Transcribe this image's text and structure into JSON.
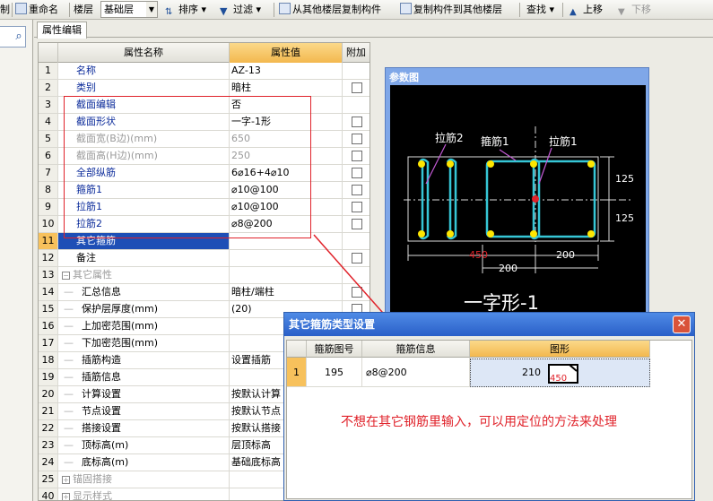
{
  "toolbar": {
    "cut_label": "制",
    "rename_label": "重命名",
    "floor_label": "楼层",
    "floor_value": "基础层",
    "sort_label": "排序",
    "filter_label": "过滤",
    "copy_from_label": "从其他楼层复制构件",
    "copy_to_label": "复制构件到其他楼层",
    "find_label": "查找",
    "up_label": "上移",
    "down_label": "下移"
  },
  "tab": {
    "label": "属性编辑"
  },
  "grid": {
    "headers": {
      "name": "属性名称",
      "value": "属性值",
      "extra": "附加"
    },
    "rows": [
      {
        "num": "1",
        "name": "名称",
        "value": "AZ-13"
      },
      {
        "num": "2",
        "name": "类别",
        "value": "暗柱"
      },
      {
        "num": "3",
        "name": "截面编辑",
        "value": "否"
      },
      {
        "num": "4",
        "name": "截面形状",
        "value": "一字-1形"
      },
      {
        "num": "5",
        "name": "截面宽(B边)(mm)",
        "value": "650"
      },
      {
        "num": "6",
        "name": "截面高(H边)(mm)",
        "value": "250"
      },
      {
        "num": "7",
        "name": "全部纵筋",
        "value": "6⌀16+4⌀10"
      },
      {
        "num": "8",
        "name": "箍筋1",
        "value": "⌀10@100"
      },
      {
        "num": "9",
        "name": "拉筋1",
        "value": "⌀10@100"
      },
      {
        "num": "10",
        "name": "拉筋2",
        "value": "⌀8@200"
      },
      {
        "num": "11",
        "name": "其它箍筋",
        "value": ""
      },
      {
        "num": "12",
        "name": "备注",
        "value": ""
      },
      {
        "num": "13",
        "name": "其它属性",
        "value": ""
      },
      {
        "num": "14",
        "name": "汇总信息",
        "value": "暗柱/端柱"
      },
      {
        "num": "15",
        "name": "保护层厚度(mm)",
        "value": "(20)"
      },
      {
        "num": "16",
        "name": "上加密范围(mm)",
        "value": ""
      },
      {
        "num": "17",
        "name": "下加密范围(mm)",
        "value": ""
      },
      {
        "num": "18",
        "name": "插筋构造",
        "value": "设置插筋"
      },
      {
        "num": "19",
        "name": "插筋信息",
        "value": ""
      },
      {
        "num": "20",
        "name": "计算设置",
        "value": "按默认计算"
      },
      {
        "num": "21",
        "name": "节点设置",
        "value": "按默认节点"
      },
      {
        "num": "22",
        "name": "搭接设置",
        "value": "按默认搭接"
      },
      {
        "num": "23",
        "name": "顶标高(m)",
        "value": "层顶标高"
      },
      {
        "num": "24",
        "name": "底标高(m)",
        "value": "基础底标高"
      },
      {
        "num": "25",
        "name": "锚固搭接",
        "value": ""
      },
      {
        "num": "40",
        "name": "显示样式",
        "value": ""
      }
    ]
  },
  "param": {
    "title": "参数图",
    "label_lajin2": "拉筋2",
    "label_gujin1": "箍筋1",
    "label_lajin1": "拉筋1",
    "dim_125a": "125",
    "dim_125b": "125",
    "dim_450": "450",
    "dim_200a": "200",
    "dim_200b": "200",
    "shape_name": "一字形-1"
  },
  "dialog": {
    "title": "其它箍筋类型设置",
    "close": "✕",
    "headers": {
      "code": "箍筋图号",
      "info": "箍筋信息",
      "shape": "图形"
    },
    "row": {
      "num": "1",
      "code": "195",
      "info": "⌀8@200",
      "shape_value": "210",
      "shape_dim": "450"
    },
    "note": "不想在其它钢筋里输入，可以用定位的方法来处理"
  },
  "colors": {
    "accent_red": "#e0222a",
    "select_blue": "#1e4fb6",
    "rebar_cyan": "#36c6d6",
    "header_orange": "#f3b84e"
  }
}
